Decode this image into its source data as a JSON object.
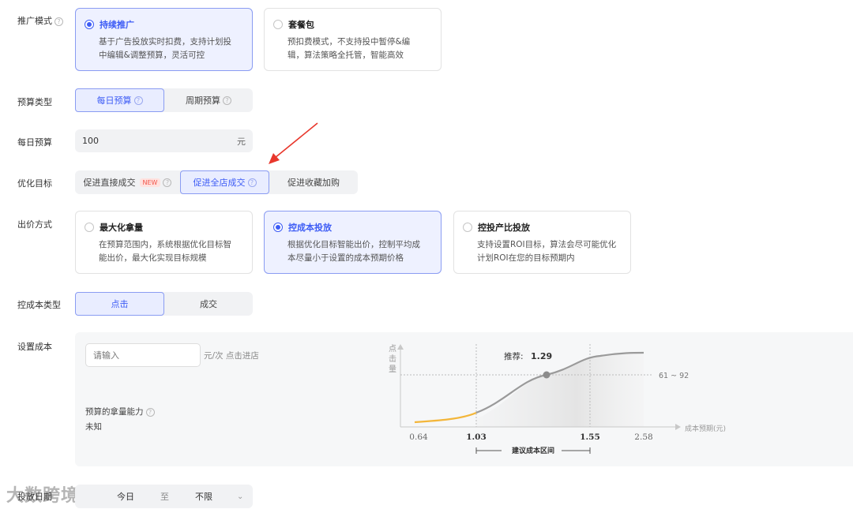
{
  "promo_mode": {
    "label": "推广模式",
    "options": [
      {
        "title": "持续推广",
        "desc_line1": "基于广告投放实时扣费，支持计划投",
        "desc_line2": "中编辑&调整预算，灵活可控",
        "selected": true
      },
      {
        "title": "套餐包",
        "desc_line1": "预扣费模式，不支持投中暂停&编",
        "desc_line2": "辑，算法策略全托管，智能高效",
        "selected": false
      }
    ]
  },
  "budget_type": {
    "label": "预算类型",
    "options": [
      "每日预算",
      "周期预算"
    ],
    "selected": "每日预算"
  },
  "daily_budget": {
    "label": "每日预算",
    "value": "100",
    "unit": "元"
  },
  "optimize_goal": {
    "label": "优化目标",
    "options": [
      {
        "label": "促进直接成交",
        "badge": "NEW"
      },
      {
        "label": "促进全店成交"
      },
      {
        "label": "促进收藏加购"
      }
    ],
    "selected": "促进全店成交"
  },
  "bid_mode": {
    "label": "出价方式",
    "options": [
      {
        "title": "最大化拿量",
        "desc_line1": "在预算范围内，系统根据优化目标智",
        "desc_line2": "能出价，最大化实现目标规模",
        "selected": false
      },
      {
        "title": "控成本投放",
        "desc_line1": "根据优化目标智能出价，控制平均成",
        "desc_line2": "本尽量小于设置的成本预期价格",
        "selected": true
      },
      {
        "title": "控投产比投放",
        "desc_line1": "支持设置ROI目标，算法会尽可能优化",
        "desc_line2": "计划ROI在您的目标预期内",
        "selected": false
      }
    ]
  },
  "cost_type": {
    "label": "控成本类型",
    "options": [
      "点击",
      "成交"
    ],
    "selected": "点击"
  },
  "set_cost": {
    "label": "设置成本",
    "placeholder": "请输入",
    "unit": "元/次 点击进店",
    "ability_label": "预算的拿量能力",
    "ability_value": "未知"
  },
  "chart_data": {
    "type": "line",
    "ylabel": "点击量",
    "xlabel": "成本预期(元)",
    "x_ticks": [
      "0.64",
      "1.03",
      "1.55",
      "2.58"
    ],
    "recommend_label": "推荐:",
    "recommend_value": "1.29",
    "range_label": "61 ~ 92",
    "suggest_label": "建议成本区间",
    "suggest_range": [
      1.03,
      1.55
    ],
    "colors": {
      "low_segment": "#f3b63a",
      "curve": "#9a9a9a",
      "point": "#8c8c8c"
    }
  },
  "launch_date": {
    "label": "投放日期",
    "start": "今日",
    "sep": "至",
    "end": "不限"
  },
  "watermark": "大数跨境"
}
